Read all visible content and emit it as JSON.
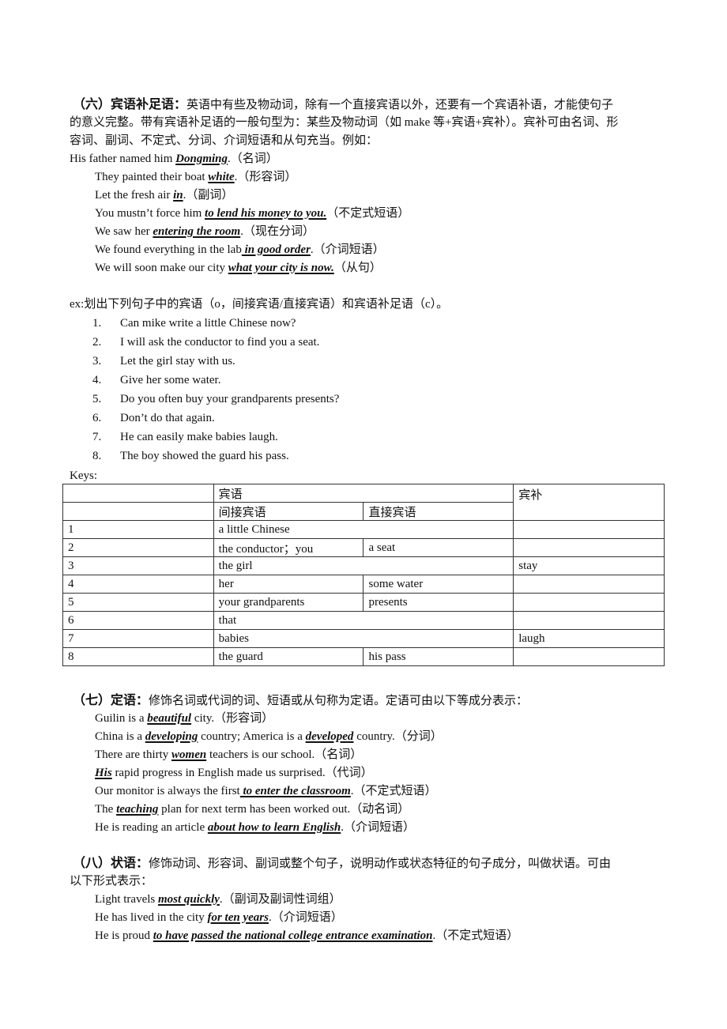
{
  "section6": {
    "label": "（六）宾语补足语：",
    "intro_line1": "英语中有些及物动词，除有一个直接宾语以外，还要有一个宾语补语，才能使句子",
    "intro_line2": "的意义完整。带有宾语补足语的一般句型为：某些及物动词（如 make 等+宾语+宾补）。宾补可由名词、形",
    "intro_line3": "容词、副词、不定式、分词、介词短语和从句充当。例如：",
    "examples": [
      {
        "pre": "His father named him ",
        "em": "Dongming",
        "post": ".（名词）"
      },
      {
        "pre": "They painted their boat ",
        "em": "white",
        "post": ".（形容词）"
      },
      {
        "pre": "Let the fresh air ",
        "em": "in",
        "post": ".（副词）"
      },
      {
        "pre": "You mustn’t force him ",
        "em": "to lend his money to you.",
        "post": "（不定式短语）"
      },
      {
        "pre": "We saw her ",
        "em": "entering the room",
        "post": ".（现在分词）"
      },
      {
        "pre": "We found everything in the lab",
        "em": " in good order",
        "post": ".（介词短语）"
      },
      {
        "pre": "We will soon make our city ",
        "em": "what your city is now.",
        "post": "（从句）"
      }
    ]
  },
  "exercise": {
    "instruction": "ex:划出下列句子中的宾语（o，间接宾语/直接宾语）和宾语补足语（c）。",
    "items": [
      {
        "num": "1.",
        "text": "Can mike write a little Chinese now?"
      },
      {
        "num": "2.",
        "text": "I will ask the conductor to find you a seat."
      },
      {
        "num": "3.",
        "text": "Let the girl stay with us."
      },
      {
        "num": "4.",
        "text": "Give her some water."
      },
      {
        "num": "5.",
        "text": "Do you often buy your grandparents presents?"
      },
      {
        "num": "6.",
        "text": "Don’t do that again."
      },
      {
        "num": "7.",
        "text": "He can easily make babies laugh."
      },
      {
        "num": "8.",
        "text": "The boy showed the guard his pass."
      }
    ],
    "keys_label": "Keys:"
  },
  "keys_table": {
    "header_object": "宾语",
    "header_complement": "宾补",
    "header_indirect": "间接宾语",
    "header_direct": "直接宾语",
    "rows": [
      {
        "num": "1",
        "indirect": "a little Chinese",
        "direct": "",
        "complement": "",
        "merged": true
      },
      {
        "num": "2",
        "indirect": "the conductor；you",
        "direct": "a seat",
        "complement": "",
        "merged": false
      },
      {
        "num": "3",
        "indirect": "the girl",
        "direct": "",
        "complement": "stay",
        "merged": true
      },
      {
        "num": "4",
        "indirect": "her",
        "direct": "some water",
        "complement": "",
        "merged": false
      },
      {
        "num": "5",
        "indirect": "your grandparents",
        "direct": "presents",
        "complement": "",
        "merged": false
      },
      {
        "num": "6",
        "indirect": "that",
        "direct": "",
        "complement": "",
        "merged": true
      },
      {
        "num": "7",
        "indirect": "babies",
        "direct": "",
        "complement": "laugh",
        "merged": true
      },
      {
        "num": "8",
        "indirect": "the guard",
        "direct": "his pass",
        "complement": "",
        "merged": false
      }
    ]
  },
  "section7": {
    "label": "（七）定语：",
    "intro": "修饰名词或代词的词、短语或从句称为定语。定语可由以下等成分表示：",
    "examples": [
      {
        "parts": [
          {
            "t": "Guilin is a "
          },
          {
            "e": "beautiful"
          },
          {
            "t": " city.（形容词）"
          }
        ]
      },
      {
        "parts": [
          {
            "t": "China is a "
          },
          {
            "e": "developing"
          },
          {
            "t": " country; America is a "
          },
          {
            "e": "developed"
          },
          {
            "t": " country.（分词）"
          }
        ]
      },
      {
        "parts": [
          {
            "t": "There are thirty "
          },
          {
            "e": "women"
          },
          {
            "t": " teachers is our school.（名词）"
          }
        ]
      },
      {
        "parts": [
          {
            "e": "His"
          },
          {
            "t": " rapid progress in English made us surprised.（代词）"
          }
        ]
      },
      {
        "parts": [
          {
            "t": "Our monitor is always the first"
          },
          {
            "e": " to enter the classroom"
          },
          {
            "t": ".（不定式短语）"
          }
        ]
      },
      {
        "parts": [
          {
            "t": "The "
          },
          {
            "e": "teaching"
          },
          {
            "t": " plan for next term has been worked out.（动名词）"
          }
        ]
      },
      {
        "parts": [
          {
            "t": "He is reading an article "
          },
          {
            "e": "about how to learn English"
          },
          {
            "t": ".（介词短语）"
          }
        ]
      }
    ]
  },
  "section8": {
    "label": "（八）状语：",
    "intro_line1": "修饰动词、形容词、副词或整个句子，说明动作或状态特征的句子成分，叫做状语。可由",
    "intro_line2": "以下形式表示：",
    "examples": [
      {
        "pre": "Light travels ",
        "em": "most quickly",
        "post": ".（副词及副词性词组）"
      },
      {
        "pre": "He has lived in the city ",
        "em": "for ten years",
        "post": ".（介词短语）"
      },
      {
        "pre": "He is proud ",
        "em": "to have passed the national college entrance examination",
        "post": ".（不定式短语）"
      }
    ]
  }
}
